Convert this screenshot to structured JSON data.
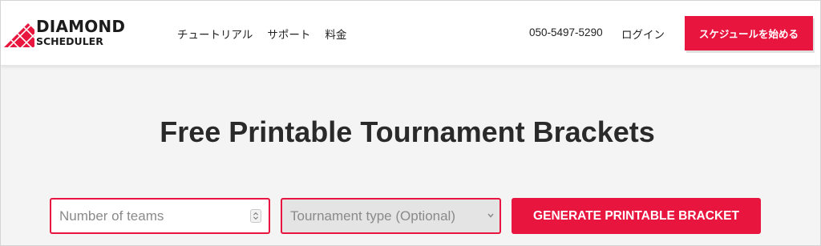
{
  "header": {
    "logo_title": "DIAMOND",
    "logo_subtitle": "SCHEDULER",
    "nav": [
      {
        "label": "チュートリアル"
      },
      {
        "label": "サポート"
      },
      {
        "label": "料金"
      }
    ],
    "phone": "050-5497-5290",
    "login_label": "ログイン",
    "cta_label": "スケジュールを始める"
  },
  "main": {
    "title": "Free Printable Tournament Brackets",
    "teams_placeholder": "Number of teams",
    "tournament_type_label": "Tournament type (Optional)",
    "generate_label": "GENERATE PRINTABLE BRACKET"
  },
  "colors": {
    "accent": "#e8153f",
    "text": "#2b2b2b",
    "background": "#f4f4f4"
  },
  "icons": {
    "logo": "diamond-grid-icon",
    "spinner": "number-spinner-icon",
    "select": "chevron-down-icon"
  }
}
